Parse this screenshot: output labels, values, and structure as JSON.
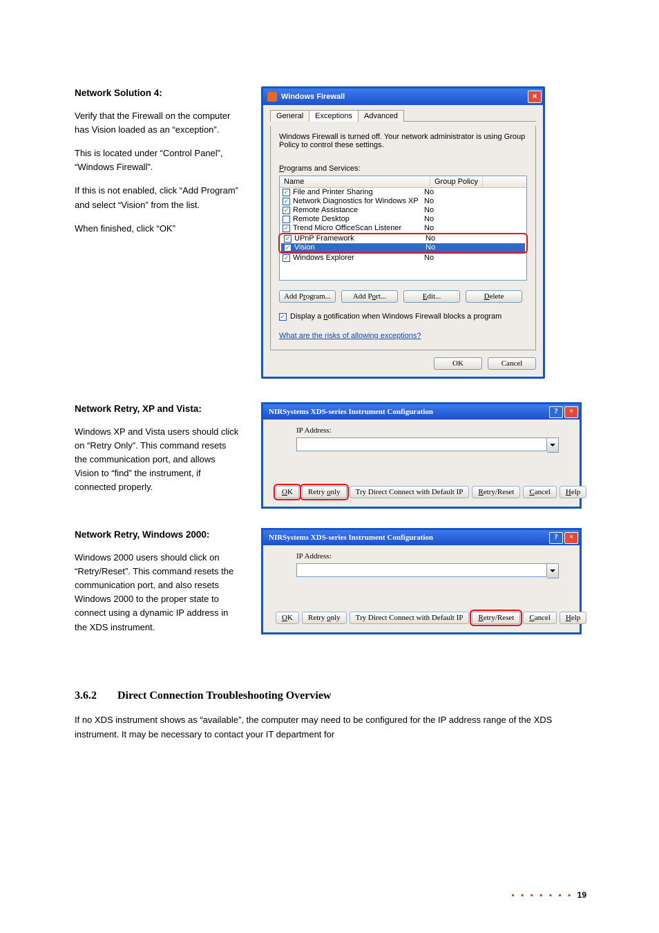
{
  "left1": {
    "h": "Network Solution 4:",
    "p1": "Verify that the Firewall on the computer has Vision loaded as an “exception”.",
    "p2": "This is located under “Control Panel”, “Windows Firewall”.",
    "p3": "If this is not enabled, click “Add Program” and select “Vision” from the list.",
    "p4": "When finished, click “OK”"
  },
  "wf": {
    "title": "Windows Firewall",
    "tabs": [
      "General",
      "Exceptions",
      "Advanced"
    ],
    "msg": "Windows Firewall is turned off. Your network administrator is using Group Policy to control these settings.",
    "listLabel": "Programs and Services:",
    "cols": [
      "Name",
      "Group Policy"
    ],
    "rows": [
      {
        "c": true,
        "n": "File and Printer Sharing",
        "g": "No"
      },
      {
        "c": true,
        "n": "Network Diagnostics for Windows XP",
        "g": "No"
      },
      {
        "c": true,
        "n": "Remote Assistance",
        "g": "No"
      },
      {
        "c": false,
        "n": "Remote Desktop",
        "g": "No"
      },
      {
        "c": true,
        "n": "Trend Micro OfficeScan Listener",
        "g": "No"
      },
      {
        "c": true,
        "n": "UPnP Framework",
        "g": "No"
      },
      {
        "c": true,
        "n": "Vision",
        "g": "No"
      },
      {
        "c": true,
        "n": "Windows Explorer",
        "g": "No"
      }
    ],
    "btns": [
      "Add Program...",
      "Add Port...",
      "Edit...",
      "Delete"
    ],
    "notify": "Display a notification when Windows Firewall blocks a program",
    "risk": "What are the risks of allowing exceptions?",
    "ok": "OK",
    "cancel": "Cancel"
  },
  "left2": {
    "h": "Network Retry, XP and Vista:",
    "p": "Windows XP and Vista users should click on “Retry Only”. This command resets the communication port, and allows Vision to “find” the instrument, if connected properly."
  },
  "left3": {
    "h": "Network Retry, Windows 2000:",
    "p": "Windows 2000 users should click on “Retry/Reset”. This command resets the communication port, and also resets Windows 2000 to the proper state to connect using a dynamic IP address in the XDS instrument."
  },
  "nir": {
    "title": "NIRSystems XDS-series Instrument Configuration",
    "ip": "IP Address:",
    "b": {
      "ok": "OK",
      "retry": "Retry only",
      "direct": "Try Direct Connect with Default IP",
      "reset": "Retry/Reset",
      "cancel": "Cancel",
      "help": "Help"
    }
  },
  "sec": {
    "num": "3.6.2",
    "title": "Direct Connection Troubleshooting Overview",
    "p": "If no XDS instrument shows as “available”, the computer may need to be configured for the IP address range of the XDS instrument. It may be necessary to contact your IT department for"
  },
  "page": "19"
}
